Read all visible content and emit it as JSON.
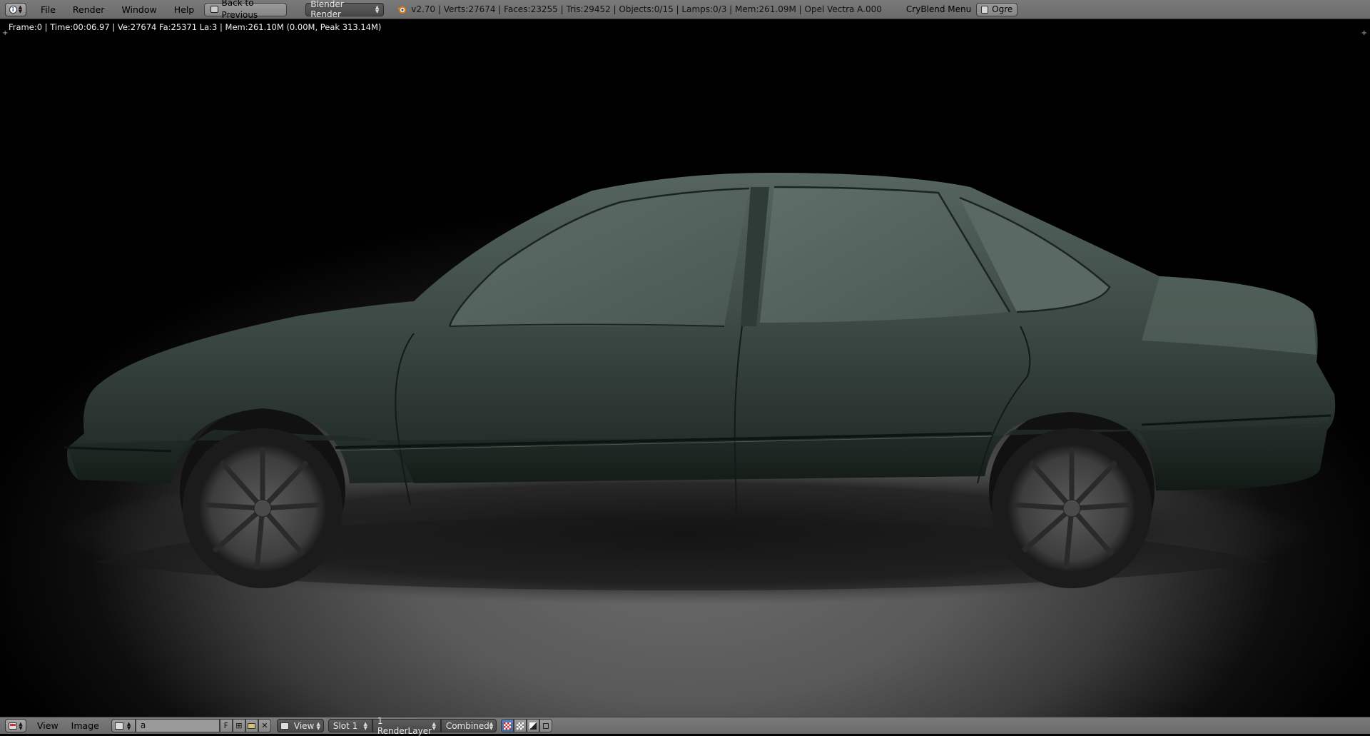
{
  "header": {
    "menus": [
      "File",
      "Render",
      "Window",
      "Help"
    ],
    "back_button": "Back to Previous",
    "render_engine": "Blender Render",
    "stats": "v2.70 | Verts:27674 | Faces:23255 | Tris:29452 | Objects:0/15 | Lamps:0/3 | Mem:261.09M | Opel Vectra A.000",
    "addon_menu": "CryBlend Menu",
    "ogre_label": "Ogre"
  },
  "viewport": {
    "render_info": "Frame:0 | Time:00:06.97 | Ve:27674 Fa:25371 La:3 | Mem:261.10M (0.00M, Peak 313.14M)",
    "render_subject": "car-render"
  },
  "footer": {
    "menus": [
      "View",
      "Image"
    ],
    "image_name": "a",
    "fake_user": "F",
    "view_mode": "View",
    "slot": "Slot 1",
    "render_layer": "1 RenderLayer",
    "pass": "Combined"
  },
  "colors": {
    "header_bg": "#6f6f6f",
    "car_body": "#3a4742",
    "dropdown_bg": "#4e4e4e"
  }
}
